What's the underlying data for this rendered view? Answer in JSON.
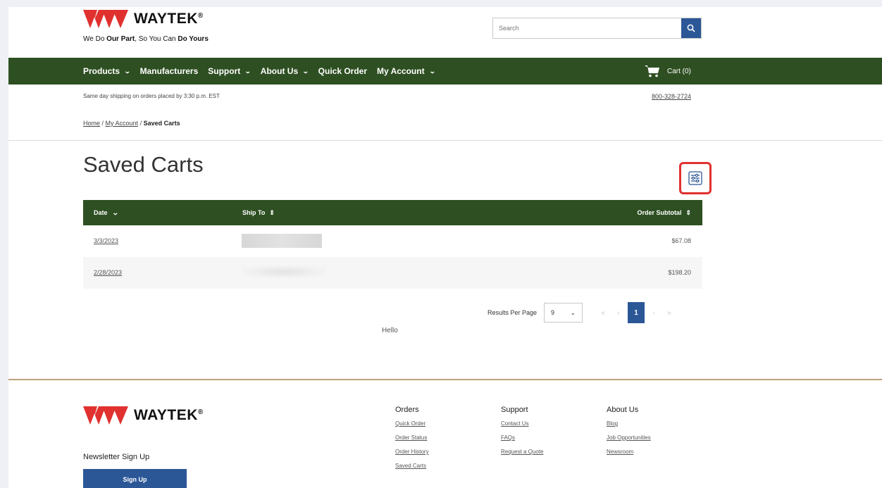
{
  "brand": {
    "name": "WAYTEK",
    "registered": "®",
    "tagline_parts": [
      "We Do ",
      "Our Part",
      ", So You Can ",
      "Do Yours"
    ],
    "accent": "#e0312f"
  },
  "search": {
    "placeholder": "Search",
    "icon": "search-icon"
  },
  "nav": {
    "items": [
      {
        "label": "Products",
        "dropdown": true
      },
      {
        "label": "Manufacturers",
        "dropdown": false
      },
      {
        "label": "Support",
        "dropdown": true
      },
      {
        "label": "About Us",
        "dropdown": true
      },
      {
        "label": "Quick Order",
        "dropdown": false
      },
      {
        "label": "My Account",
        "dropdown": true
      }
    ],
    "cart_label": "Cart (0)",
    "color": "#2e4f22"
  },
  "ship_note": "Same day shipping on orders placed by 3:30 p.m. EST",
  "phone": "800-328-2724",
  "breadcrumb": {
    "home": "Home",
    "sep": " / ",
    "account": "My Account",
    "current": "Saved Carts"
  },
  "page_title": "Saved Carts",
  "table": {
    "headers": {
      "date": "Date",
      "ship_to": "Ship To",
      "subtotal": "Order Subtotal"
    },
    "rows": [
      {
        "date": "3/3/2023",
        "amount": "$67.08"
      },
      {
        "date": "2/28/2023",
        "amount": "$198.20"
      }
    ]
  },
  "pagination": {
    "results_per_page_label": "Results Per Page",
    "results_per_page_value": "9",
    "current_page": "1"
  },
  "hello_text": "Hello",
  "footer": {
    "newsletter_title": "Newsletter Sign Up",
    "signup_label": "Sign Up",
    "columns": [
      {
        "title": "Orders",
        "links": [
          "Quick Order",
          "Order Status",
          "Order History",
          "Saved Carts"
        ]
      },
      {
        "title": "Support",
        "links": [
          "Contact Us",
          "FAQs",
          "Request a Quote"
        ]
      },
      {
        "title": "About Us",
        "links": [
          "Blog",
          "Job Opportunities",
          "Newsroom"
        ]
      }
    ]
  }
}
